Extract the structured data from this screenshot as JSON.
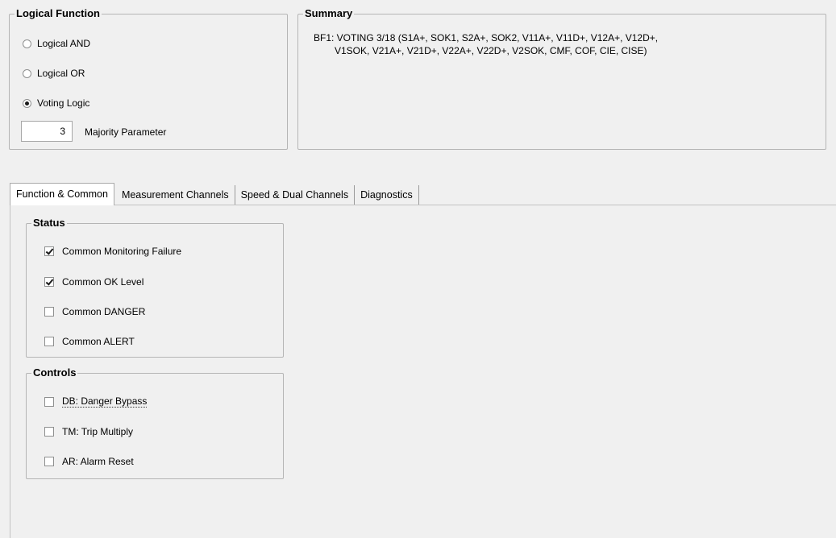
{
  "logical_function": {
    "title": "Logical Function",
    "options": [
      {
        "label": "Logical AND",
        "selected": false
      },
      {
        "label": "Logical OR",
        "selected": false
      },
      {
        "label": "Voting Logic",
        "selected": true
      }
    ],
    "majority_value": "3",
    "majority_label": "Majority Parameter"
  },
  "summary": {
    "title": "Summary",
    "line1": "BF1: VOTING 3/18 (S1A+, SOK1, S2A+, SOK2, V11A+, V11D+, V12A+, V12D+,",
    "line2": "V1SOK, V21A+, V21D+, V22A+, V22D+, V2SOK, CMF, COF, CIE, CISE)"
  },
  "tabs": [
    {
      "label": "Function & Common",
      "active": true
    },
    {
      "label": "Measurement Channels",
      "active": false
    },
    {
      "label": "Speed & Dual Channels",
      "active": false
    },
    {
      "label": "Diagnostics",
      "active": false
    }
  ],
  "status": {
    "title": "Status",
    "items": [
      {
        "label": "Common Monitoring Failure",
        "checked": true
      },
      {
        "label": "Common OK Level",
        "checked": true
      },
      {
        "label": "Common DANGER",
        "checked": false
      },
      {
        "label": "Common ALERT",
        "checked": false
      }
    ]
  },
  "controls": {
    "title": "Controls",
    "items": [
      {
        "label": "DB: Danger Bypass",
        "checked": false
      },
      {
        "label": "TM: Trip Multiply",
        "checked": false
      },
      {
        "label": "AR: Alarm Reset",
        "checked": false
      }
    ]
  }
}
